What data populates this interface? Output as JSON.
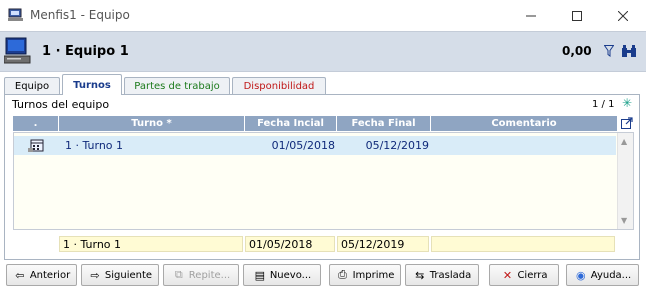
{
  "window": {
    "title": "Menfis1 - Equipo"
  },
  "header": {
    "record_title": "1 · Equipo 1",
    "amount": "0,00"
  },
  "tabs": [
    {
      "label": "Equipo"
    },
    {
      "label": "Turnos"
    },
    {
      "label": "Partes de trabajo"
    },
    {
      "label": "Disponibilidad"
    }
  ],
  "panel": {
    "title": "Turnos del equipo",
    "counter": "1 / 1",
    "columns": [
      ".",
      "Turno *",
      "Fecha Incial",
      "Fecha Final",
      "Comentario"
    ],
    "rows": [
      {
        "turno": "1 · Turno 1",
        "fecha_inicial": "01/05/2018",
        "fecha_final": "05/12/2019",
        "comentario": ""
      }
    ],
    "footer": {
      "turno": "1 · Turno 1",
      "fecha_inicial": "01/05/2018",
      "fecha_final": "05/12/2019",
      "comentario": ""
    }
  },
  "buttons": {
    "anterior": "Anterior",
    "siguiente": "Siguiente",
    "repite": "Repite...",
    "nuevo": "Nuevo...",
    "imprime": "Imprime",
    "traslada": "Traslada",
    "cierra": "Cierra",
    "ayuda": "Ayuda..."
  },
  "colors": {
    "header_bg": "#d5dde8",
    "grid_header": "#8fa5c2",
    "selected_row": "#d9ecf8",
    "input_bg": "#fffbd4"
  }
}
